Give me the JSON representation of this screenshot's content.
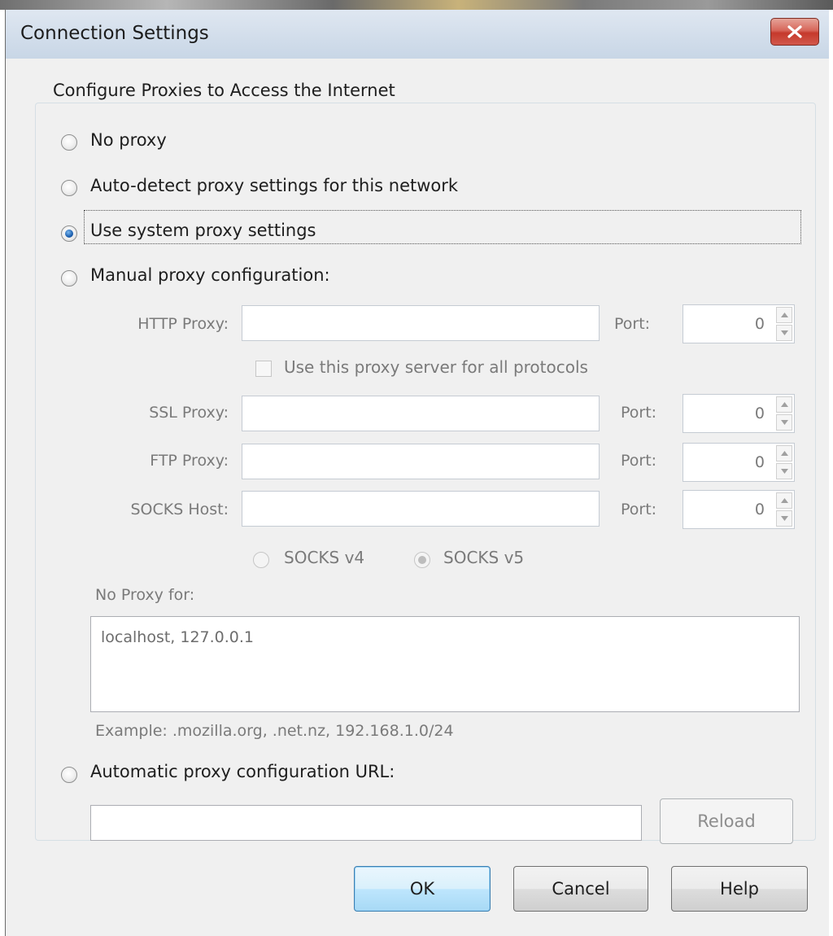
{
  "window": {
    "title": "Connection Settings"
  },
  "group": {
    "legend": "Configure Proxies to Access the Internet"
  },
  "options": {
    "no_proxy": "No proxy",
    "auto_detect": "Auto-detect proxy settings for this network",
    "use_system": "Use system proxy settings",
    "manual": "Manual proxy configuration:",
    "auto_url": "Automatic proxy configuration URL:"
  },
  "selected_option": "use_system",
  "manual": {
    "http_label": "HTTP Proxy:",
    "ssl_label": "SSL Proxy:",
    "ftp_label": "FTP Proxy:",
    "socks_label": "SOCKS Host:",
    "port_label": "Port:",
    "http_value": "",
    "ssl_value": "",
    "ftp_value": "",
    "socks_value": "",
    "http_port": "0",
    "ssl_port": "0",
    "ftp_port": "0",
    "socks_port": "0",
    "use_for_all": "Use this proxy server for all protocols",
    "use_for_all_checked": false,
    "socks_v4": "SOCKS v4",
    "socks_v5": "SOCKS v5",
    "socks_selected": "socks_v5"
  },
  "no_proxy": {
    "label": "No Proxy for:",
    "value": "localhost, 127.0.0.1",
    "example": "Example: .mozilla.org, .net.nz, 192.168.1.0/24"
  },
  "auto_url": {
    "value": "",
    "reload": "Reload"
  },
  "buttons": {
    "ok": "OK",
    "cancel": "Cancel",
    "help": "Help"
  },
  "colors": {
    "accent": "#1c5fae",
    "close": "#c5392c",
    "disabled_text": "#7a7a7a"
  }
}
